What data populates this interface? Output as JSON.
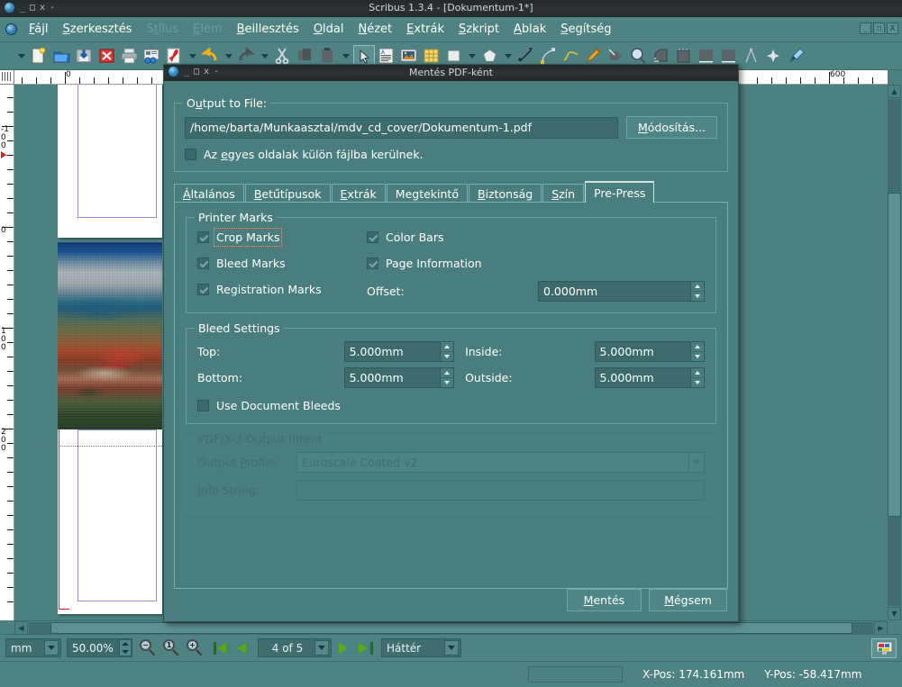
{
  "window": {
    "title": "Scribus 1.3.4 - [Dokumentum-1*]",
    "controls": {
      "minimize": "_",
      "maximize": "□",
      "close": "x",
      "shade": "-"
    },
    "right_controls": {
      "minimize": "_",
      "restore": "❐",
      "close": "X"
    }
  },
  "menubar": {
    "items": [
      {
        "label": "Fájl",
        "accel": "F",
        "disabled": false
      },
      {
        "label": "Szerkesztés",
        "accel": "S",
        "disabled": false
      },
      {
        "label": "Stílus",
        "accel": "t",
        "disabled": true
      },
      {
        "label": "Elem",
        "accel": "E",
        "disabled": true
      },
      {
        "label": "Beillesztés",
        "accel": "B",
        "disabled": false
      },
      {
        "label": "Oldal",
        "accel": "O",
        "disabled": false
      },
      {
        "label": "Nézet",
        "accel": "N",
        "disabled": false
      },
      {
        "label": "Extrák",
        "accel": "E",
        "disabled": false
      },
      {
        "label": "Szkript",
        "accel": "S",
        "disabled": false
      },
      {
        "label": "Ablak",
        "accel": "A",
        "disabled": false
      },
      {
        "label": "Segítség",
        "accel": "S",
        "disabled": false
      }
    ]
  },
  "toolbar": {
    "icons": [
      "new-document-icon",
      "open-folder-icon",
      "save-icon",
      "close-document-icon",
      "print-icon",
      "print-preview-icon",
      "export-pdf-icon",
      "undo-icon",
      "redo-icon",
      "cut-icon",
      "copy-icon",
      "paste-icon",
      "select-item-icon",
      "text-frame-icon",
      "image-frame-icon",
      "table-icon",
      "shape-icon",
      "polygon-icon",
      "line-icon",
      "bezier-curve-icon",
      "freehand-line-icon",
      "edit-contents-icon",
      "rotate-item-icon",
      "zoom-icon",
      "link-text-frames-icon",
      "unlink-text-frames-icon",
      "measurements-icon",
      "copy-item-properties-icon",
      "eyedropper-icon"
    ]
  },
  "rulers": {
    "unit": "mm",
    "horizontal_labels": [
      "0",
      "600"
    ],
    "vertical_labels": [
      "-100",
      "0",
      "100",
      "200"
    ]
  },
  "dialog": {
    "title": "Mentés PDF-ként",
    "controls": {
      "minimize": "_",
      "maximize": "□",
      "close": "x",
      "shade": "-"
    },
    "output_to_file": {
      "group_label": "Output to File:",
      "path_value": "/home/barta/Munkaasztal/mdv_cd_cover/Dokumentum-1.pdf",
      "change_button": "Módosítás...",
      "change_button_accel": "M",
      "separate_files_label": "Az egyes oldalak külön fájlba kerülnek.",
      "separate_files_accel": "e",
      "separate_files_checked": false
    },
    "tabs": [
      {
        "label": "Általános",
        "accel": "Á",
        "active": false
      },
      {
        "label": "Betűtípusok",
        "accel": "B",
        "active": false
      },
      {
        "label": "Extrák",
        "accel": "E",
        "active": false
      },
      {
        "label": "Megtekintő",
        "accel": "",
        "active": false
      },
      {
        "label": "Biztonság",
        "accel": "B",
        "active": false
      },
      {
        "label": "Szín",
        "accel": "S",
        "active": false
      },
      {
        "label": "Pre-Press",
        "accel": "",
        "active": true
      }
    ],
    "printer_marks": {
      "group_label": "Printer Marks",
      "crop_marks": {
        "label": "Crop Marks",
        "checked": true,
        "focused": true
      },
      "bleed_marks": {
        "label": "Bleed Marks",
        "checked": true
      },
      "registration_marks": {
        "label": "Registration Marks",
        "checked": true
      },
      "color_bars": {
        "label": "Color Bars",
        "checked": true
      },
      "page_information": {
        "label": "Page Information",
        "checked": true
      },
      "offset_label": "Offset:",
      "offset_value": "0.000mm"
    },
    "bleed_settings": {
      "group_label": "Bleed Settings",
      "top_label": "Top:",
      "top_value": "5.000mm",
      "bottom_label": "Bottom:",
      "bottom_value": "5.000mm",
      "inside_label": "Inside:",
      "inside_value": "5.000mm",
      "outside_label": "Outside:",
      "outside_value": "5.000mm",
      "use_document_bleeds_label": "Use Document Bleeds",
      "use_document_bleeds_checked": false
    },
    "output_intent": {
      "group_label": "PDF/X-3 Output Intent",
      "profile_label": "Output Profile:",
      "profile_accel": "P",
      "profile_value": "Euroscale Coated v2",
      "info_label": "Info String:",
      "info_accel": "I",
      "info_value": "",
      "disabled": true
    },
    "buttons": {
      "save": "Mentés",
      "save_accel": "M",
      "cancel": "Mégsem",
      "cancel_accel": "M"
    }
  },
  "statusbar": {
    "unit_value": "mm",
    "zoom_value": "50.00%",
    "page_value": "4 of 5",
    "layer_value": "Háttér",
    "icons": [
      "zoom-out-icon",
      "zoom-100-icon",
      "zoom-in-icon",
      "first-page-icon",
      "previous-page-icon",
      "next-page-icon",
      "last-page-icon",
      "preview-mode-icon"
    ]
  },
  "statusline": {
    "x_pos": "X-Pos: 174.161mm",
    "y_pos": "Y-Pos: -58.417mm"
  },
  "colors": {
    "app_background": "#4d8080",
    "dialog_background": "#4a7d7d",
    "titlebar": "#2c3235",
    "field_background": "#3d6b6b",
    "text": "#ffffff",
    "disabled_text": "#3f6f6f",
    "accent_green": "#5aa81c",
    "guide_blue": "#8f8fe0",
    "guide_red": "#d01b1b"
  }
}
